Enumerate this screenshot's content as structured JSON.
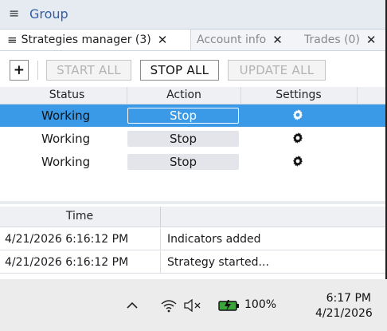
{
  "group": {
    "menu_icon": "≡",
    "title": "Group"
  },
  "tabs": [
    {
      "menu_icon": "≡",
      "label": "Strategies manager (3)",
      "close": "✕"
    },
    {
      "label": "Account info",
      "close": "✕"
    },
    {
      "label": "Trades (0)",
      "close": "✕"
    }
  ],
  "toolbar": {
    "add_label": "+",
    "start_all": "START ALL",
    "stop_all": "STOP ALL",
    "update_all": "UPDATE ALL"
  },
  "grid": {
    "columns": [
      "Status",
      "Action",
      "Settings"
    ],
    "rows": [
      {
        "status": "Working",
        "action": "Stop",
        "settings_icon": "gear-icon"
      },
      {
        "status": "Working",
        "action": "Stop",
        "settings_icon": "gear-icon"
      },
      {
        "status": "Working",
        "action": "Stop",
        "settings_icon": "gear-icon"
      }
    ]
  },
  "log": {
    "columns": [
      "Time",
      ""
    ],
    "rows": [
      {
        "time": "4/21/2026 6:16:12 PM",
        "message": "Indicators added"
      },
      {
        "time": "4/21/2026 6:16:12 PM",
        "message": "Strategy started..."
      }
    ]
  },
  "taskbar": {
    "chevron": "^",
    "battery_percent": "100%",
    "time": "6:17 PM",
    "date": "4/21/2026"
  },
  "colors": {
    "selection": "#3a9ae8",
    "group_title": "#2f5fa8",
    "battery": "#3aa53a"
  }
}
